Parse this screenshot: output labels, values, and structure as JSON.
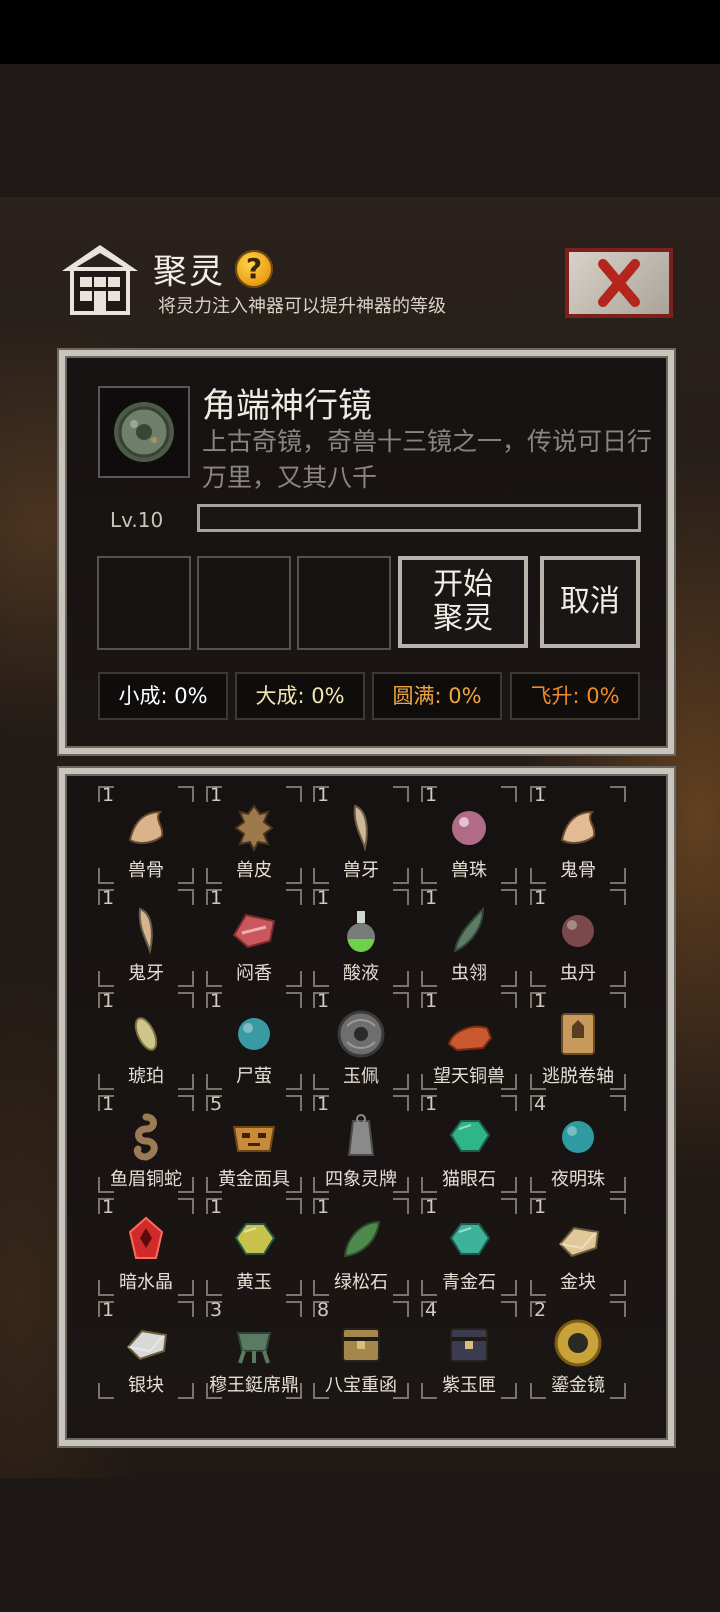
{
  "header": {
    "title": "聚灵",
    "help_symbol": "?",
    "subtitle": "将灵力注入神器可以提升神器的等级"
  },
  "artifact": {
    "name": "角端神行镜",
    "description": "上古奇镜，奇兽十三镜之一，传说可日行万里，又其八千",
    "level": "Lv.10",
    "progress": 0
  },
  "actions": {
    "start": "开始聚灵",
    "cancel": "取消"
  },
  "stats": [
    {
      "text": "小成: 0%",
      "color": "#ffffff"
    },
    {
      "text": "大成: 0%",
      "color": "#f3e6b0"
    },
    {
      "text": "圆满: 0%",
      "color": "#f0a640"
    },
    {
      "text": "飞升: 0%",
      "color": "#f08a2a"
    }
  ],
  "inventory": [
    {
      "count": "1",
      "name": "兽骨",
      "icon": "bone-icon",
      "color": "#d9b48a"
    },
    {
      "count": "1",
      "name": "兽皮",
      "icon": "hide-icon",
      "color": "#9c7a4c"
    },
    {
      "count": "1",
      "name": "兽牙",
      "icon": "fang-icon",
      "color": "#cdb89a"
    },
    {
      "count": "1",
      "name": "兽珠",
      "icon": "pearl-icon",
      "color": "#b06c86"
    },
    {
      "count": "1",
      "name": "鬼骨",
      "icon": "bone-icon",
      "color": "#e0bb93"
    },
    {
      "count": "1",
      "name": "鬼牙",
      "icon": "fang-icon",
      "color": "#d3b58e"
    },
    {
      "count": "1",
      "name": "闷香",
      "icon": "meat-icon",
      "color": "#c8585e"
    },
    {
      "count": "1",
      "name": "酸液",
      "icon": "potion-icon",
      "color": "#6fd04a"
    },
    {
      "count": "1",
      "name": "虫翎",
      "icon": "feather-icon",
      "color": "#5d7c66"
    },
    {
      "count": "1",
      "name": "虫丹",
      "icon": "orb-icon",
      "color": "#7a4a4a"
    },
    {
      "count": "1",
      "name": "琥珀",
      "icon": "seed-icon",
      "color": "#cfc48c"
    },
    {
      "count": "1",
      "name": "尸萤",
      "icon": "orb-icon",
      "color": "#3a9aa4"
    },
    {
      "count": "1",
      "name": "玉佩",
      "icon": "jade-disc-icon",
      "color": "#6e6e6e"
    },
    {
      "count": "1",
      "name": "望天铜兽",
      "icon": "beast-statue-icon",
      "color": "#c9582e"
    },
    {
      "count": "1",
      "name": "逃脱卷轴",
      "icon": "scroll-icon",
      "color": "#c79a5c"
    },
    {
      "count": "1",
      "name": "鱼眉铜蛇",
      "icon": "snake-icon",
      "color": "#9b7a55"
    },
    {
      "count": "5",
      "name": "黄金面具",
      "icon": "mask-icon",
      "color": "#c98a3a"
    },
    {
      "count": "1",
      "name": "四象灵牌",
      "icon": "tablet-icon",
      "color": "#8a8a8a"
    },
    {
      "count": "1",
      "name": "猫眼石",
      "icon": "gem-icon",
      "color": "#2fb58a"
    },
    {
      "count": "4",
      "name": "夜明珠",
      "icon": "orb-icon",
      "color": "#2f9aa0"
    },
    {
      "count": "1",
      "name": "暗水晶",
      "icon": "crystal-icon",
      "color": "#d12a2a"
    },
    {
      "count": "1",
      "name": "黄玉",
      "icon": "gem-icon",
      "color": "#c9c24a"
    },
    {
      "count": "1",
      "name": "绿松石",
      "icon": "leaf-icon",
      "color": "#4f8a4c"
    },
    {
      "count": "1",
      "name": "青金石",
      "icon": "gem-icon",
      "color": "#3fb39a"
    },
    {
      "count": "1",
      "name": "金块",
      "icon": "ingot-icon",
      "color": "#e0c89a"
    },
    {
      "count": "1",
      "name": "银块",
      "icon": "ingot-icon",
      "color": "#d8d8d8"
    },
    {
      "count": "3",
      "name": "穆王鋌席鼎",
      "icon": "cauldron-icon",
      "color": "#5a7a62"
    },
    {
      "count": "8",
      "name": "八宝重函",
      "icon": "chest-icon",
      "color": "#a5874e"
    },
    {
      "count": "4",
      "name": "紫玉匣",
      "icon": "chest-icon",
      "color": "#3b3b52"
    },
    {
      "count": "2",
      "name": "鎏金镜",
      "icon": "mirror-icon",
      "color": "#c9a23a"
    }
  ]
}
